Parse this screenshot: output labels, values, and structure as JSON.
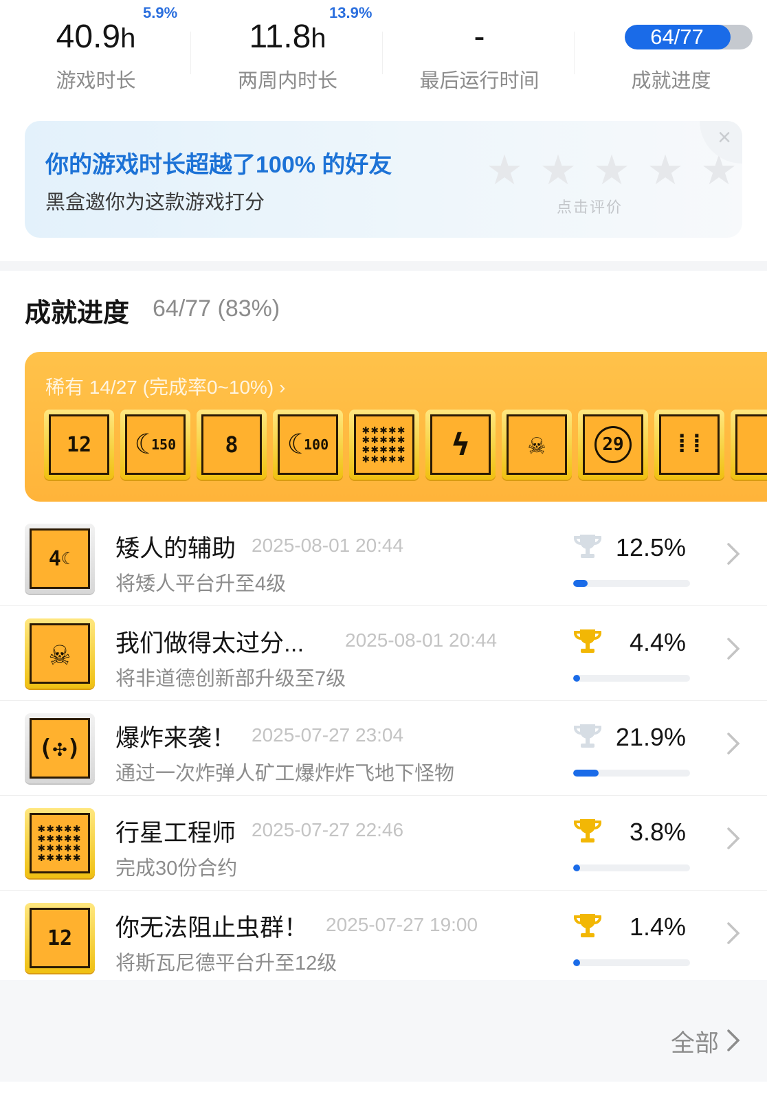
{
  "stats": [
    {
      "value": "40.9",
      "unit": "h",
      "delta": "5.9%",
      "label": "游戏时长"
    },
    {
      "value": "11.8",
      "unit": "h",
      "delta": "13.9%",
      "label": "两周内时长"
    },
    {
      "value": "-",
      "unit": "",
      "delta": "",
      "label": "最后运行时间"
    },
    {
      "value": "64/77",
      "unit": "",
      "delta": "",
      "label": "成就进度",
      "progress": 0.83
    }
  ],
  "rating_card": {
    "title": "你的游戏时长超越了100% 的好友",
    "subtitle": "黑盒邀你为这款游戏打分",
    "hint": "点击评价",
    "close_icon": "close-icon",
    "star_icon": "star-icon"
  },
  "achievements": {
    "title": "成就进度",
    "count": "64/77 (83%)",
    "rare": {
      "label": "稀有 14/27 (完成率0~10%)",
      "chevron": "›",
      "icons": [
        "12",
        "150",
        "8",
        "100",
        "grid",
        "bolt",
        "skull",
        "29",
        "bars"
      ]
    },
    "list": [
      {
        "name": "矮人的辅助",
        "time": "2025-08-01 20:44",
        "desc": "将矮人平台升至4级",
        "trophy": "silver",
        "pct": "12.5%",
        "progress": 0.125,
        "frame": "silver",
        "glyph": "4"
      },
      {
        "name": "我们做得太过分...",
        "time": "2025-08-01 20:44",
        "desc": "将非道德创新部升级至7级",
        "trophy": "gold",
        "pct": "4.4%",
        "progress": 0.044,
        "frame": "gold",
        "glyph": "skull"
      },
      {
        "name": "爆炸来袭！",
        "time": "2025-07-27 23:04",
        "desc": "通过一次炸弹人矿工爆炸炸飞地下怪物",
        "trophy": "silver",
        "pct": "21.9%",
        "progress": 0.219,
        "frame": "silver",
        "glyph": "target"
      },
      {
        "name": "行星工程师",
        "time": "2025-07-27 22:46",
        "desc": "完成30份合约",
        "trophy": "gold",
        "pct": "3.8%",
        "progress": 0.038,
        "frame": "gold",
        "glyph": "grid"
      },
      {
        "name": "你无法阻止虫群！",
        "time": "2025-07-27 19:00",
        "desc": "将斯瓦尼德平台升至12级",
        "trophy": "gold",
        "pct": "1.4%",
        "progress": 0.014,
        "frame": "gold",
        "glyph": "12"
      }
    ],
    "all_label": "全部"
  },
  "colors": {
    "accent": "#1a6be8",
    "rare_bg": "#ffb43a",
    "gold": "#f2b705",
    "silver": "#d0d7de"
  }
}
